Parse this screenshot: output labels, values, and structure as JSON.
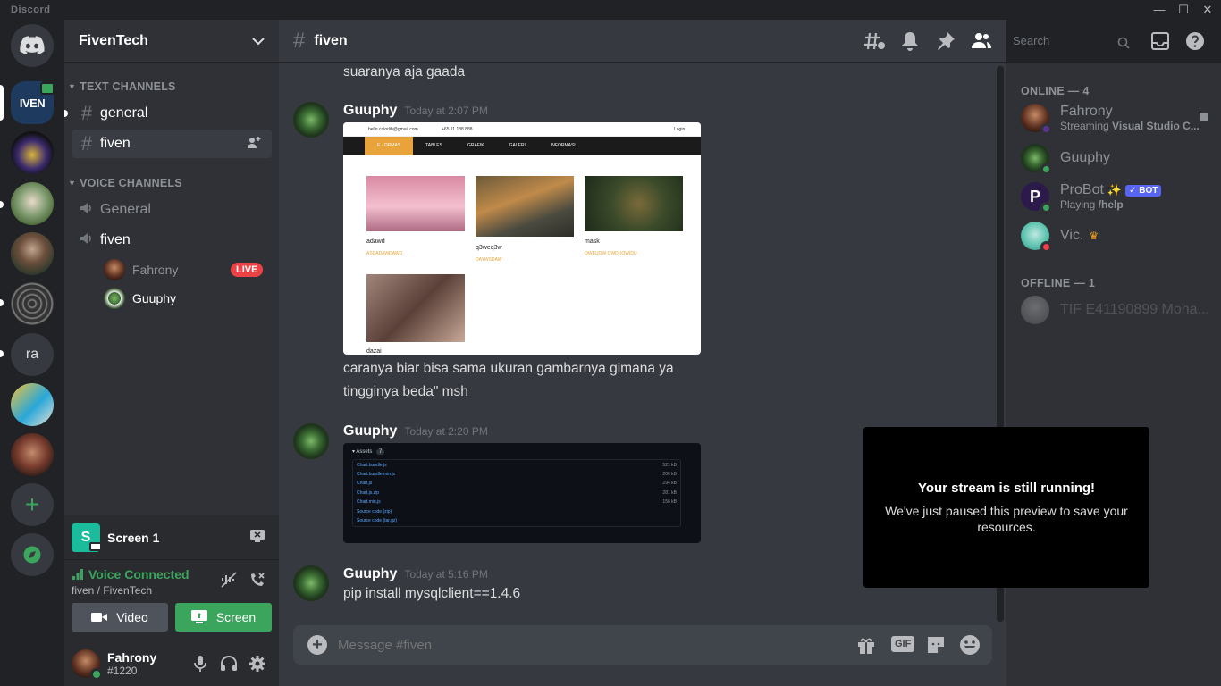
{
  "app": {
    "brand": "Discord"
  },
  "servers": {
    "dm_label": "Discord",
    "ra_label": "ra"
  },
  "sidebar": {
    "server_name": "FivenTech",
    "text_category": "TEXT CHANNELS",
    "voice_category": "VOICE CHANNELS",
    "text_channels": [
      "general",
      "fiven"
    ],
    "voice_channels": [
      "General",
      "fiven"
    ],
    "voice_users": [
      {
        "name": "Fahrony",
        "badge": "LIVE"
      },
      {
        "name": "Guuphy"
      }
    ],
    "stream": {
      "title": "Screen 1",
      "avatar_letter": "S"
    },
    "voice": {
      "status": "Voice Connected",
      "location": "fiven / FivenTech",
      "video_label": "Video",
      "screen_label": "Screen"
    },
    "user": {
      "name": "Fahrony",
      "tag": "#1220"
    }
  },
  "header": {
    "channel": "fiven",
    "search_placeholder": "Search"
  },
  "messages": {
    "m0": {
      "text": "suaranya aja gaada"
    },
    "m1": {
      "author": "Guuphy",
      "time": "Today at 2:07 PM",
      "text1": "caranya biar bisa sama ukuran gambarnya gimana ya",
      "text2": "tingginya beda\" msh",
      "preview": {
        "email": "hello.colorlib@gmail.com",
        "phone": "+65 11.188.888",
        "login": "Login",
        "nav": [
          "E - ORMAS",
          "TABLES",
          "GRAFIK",
          "GALERI",
          "INFORMASI"
        ],
        "cards": [
          {
            "title": "adawd",
            "sub": "ASDADAWDAWD"
          },
          {
            "title": "q3weq3w",
            "sub": "DAYWSDAW"
          },
          {
            "title": "mask",
            "sub": "QWEUQW QWDUQWIDU"
          },
          {
            "title": "dazai",
            "sub": ""
          }
        ]
      }
    },
    "m2": {
      "author": "Guuphy",
      "time": "Today at 2:20 PM",
      "assets": {
        "title": "Assets",
        "count": "7",
        "files": [
          {
            "name": "Chart.bundle.js",
            "size": "521 kB"
          },
          {
            "name": "Chart.bundle.min.js",
            "size": "206 kB"
          },
          {
            "name": "Chart.js",
            "size": "294 kB"
          },
          {
            "name": "Chart.js.zip",
            "size": "281 kB"
          },
          {
            "name": "Chart.min.js",
            "size": "156 kB"
          },
          {
            "name": "Source code (zip)",
            "size": ""
          },
          {
            "name": "Source code (tar.gz)",
            "size": ""
          }
        ]
      }
    },
    "m3": {
      "author": "Guuphy",
      "time": "Today at 5:16 PM",
      "text": "pip install mysqlclient==1.4.6"
    }
  },
  "composer": {
    "placeholder": "Message #fiven",
    "gif_label": "GIF"
  },
  "members": {
    "online_header": "ONLINE — 4",
    "offline_header": "OFFLINE — 1",
    "online": [
      {
        "name": "Fahrony",
        "sub_prefix": "Streaming ",
        "sub_bold": "Visual Studio C...",
        "status": "streaming"
      },
      {
        "name": "Guuphy",
        "status": "online"
      },
      {
        "name": "ProBot",
        "badge": "BOT",
        "sub_prefix": "Playing ",
        "sub_bold": "/help",
        "status": "online"
      },
      {
        "name": "Vic.",
        "status": "dnd"
      }
    ],
    "offline": [
      {
        "name": "TIF E41190899 Moha..."
      }
    ]
  },
  "popup": {
    "title": "Your stream is still running!",
    "text": "We've just paused this preview to save your resources."
  },
  "colors": {
    "accent": "#5865f2",
    "green": "#3ba55d",
    "red": "#ed4245",
    "streaming": "#593695",
    "dnd": "#ed4245"
  }
}
